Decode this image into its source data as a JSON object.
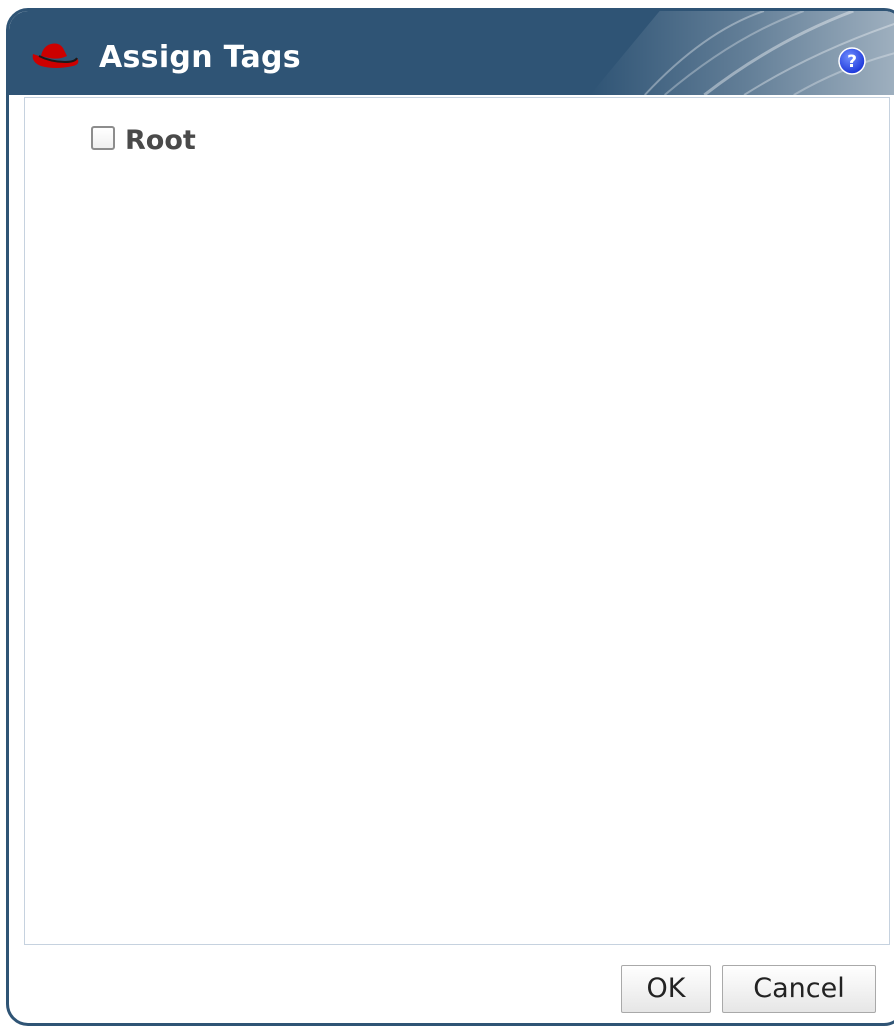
{
  "dialog": {
    "title": "Assign Tags",
    "help_icon": "question-mark-icon",
    "logo_icon": "red-hat-logo-icon",
    "header_color": "#2f5475",
    "accent_color": "#cc0000"
  },
  "tags": {
    "items": [
      {
        "label": "Root",
        "checked": false
      }
    ]
  },
  "footer": {
    "ok_label": "OK",
    "cancel_label": "Cancel"
  }
}
